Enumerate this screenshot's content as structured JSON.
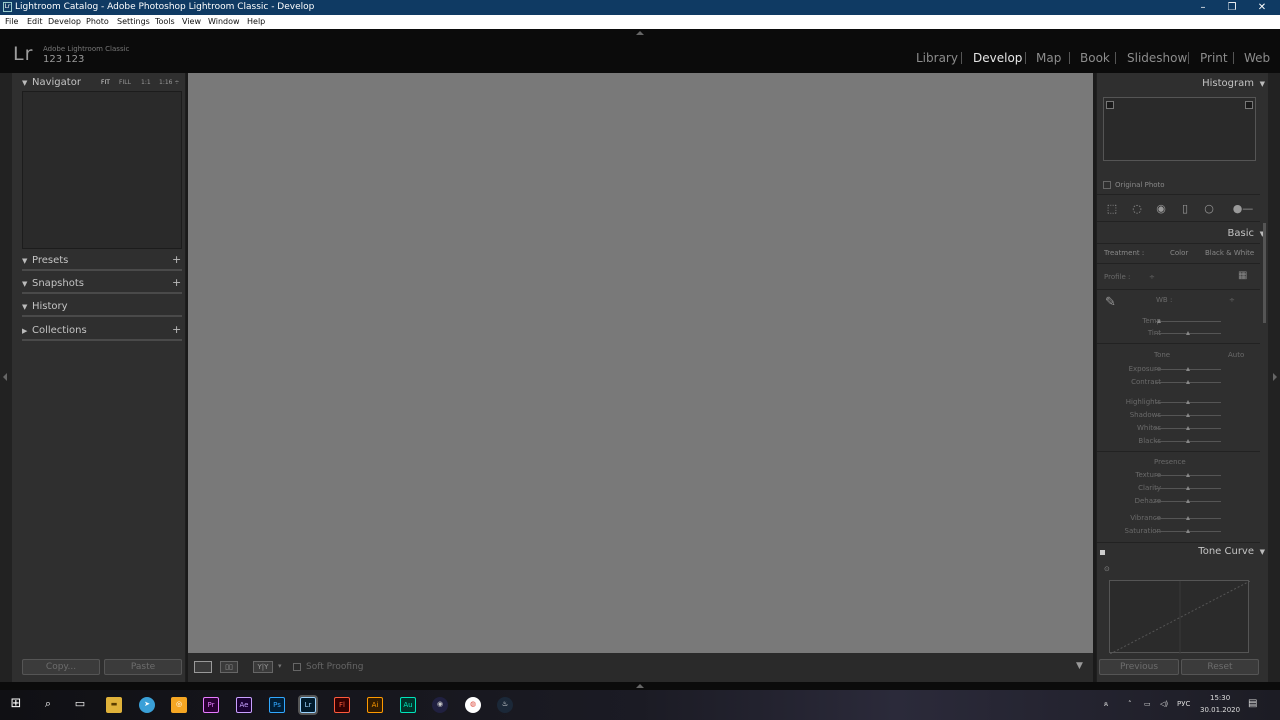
{
  "window": {
    "title": "Lightroom Catalog - Adobe Photoshop Lightroom Classic - Develop",
    "minimize": "–",
    "maximize": "❐",
    "close": "✕",
    "app_icon_text": "Lr"
  },
  "menu": [
    "File",
    "Edit",
    "Develop",
    "Photo",
    "Settings",
    "Tools",
    "View",
    "Window",
    "Help"
  ],
  "identity": {
    "logo": "Lr",
    "app_name": "Adobe Lightroom Classic",
    "plate": "123 123"
  },
  "modules": [
    "Library",
    "Develop",
    "Map",
    "Book",
    "Slideshow",
    "Print",
    "Web"
  ],
  "active_module": "Develop",
  "left_panel": {
    "navigator": {
      "title": "Navigator",
      "options": [
        "FIT",
        "FILL",
        "1:1",
        "1:16 ÷"
      ]
    },
    "presets": "Presets",
    "snapshots": "Snapshots",
    "history": "History",
    "collections": "Collections",
    "copy_button": "Copy...",
    "paste_button": "Paste",
    "add": "+"
  },
  "toolbar": {
    "soft_proofing": "Soft Proofing",
    "before_after": "Y|Y"
  },
  "right_panel": {
    "histogram": {
      "title": "Histogram",
      "original_photo": "Original Photo"
    },
    "basic": {
      "title": "Basic",
      "treatment_label": "Treatment :",
      "treatment_color": "Color",
      "treatment_bw": "Black & White",
      "profile_label": "Profile :",
      "profile_value": "÷",
      "wb_label": "WB :",
      "wb_value": "÷",
      "temp": "Temp",
      "tint": "Tint",
      "tone_label": "Tone",
      "auto": "Auto",
      "exposure": "Exposure",
      "contrast": "Contrast",
      "highlights": "Highlights",
      "shadows": "Shadows",
      "whites": "Whites",
      "blacks": "Blacks",
      "presence_label": "Presence",
      "texture": "Texture",
      "clarity": "Clarity",
      "dehaze": "Dehaze",
      "vibrance": "Vibrance",
      "saturation": "Saturation"
    },
    "tone_curve": {
      "title": "Tone Curve"
    },
    "previous_button": "Previous",
    "reset_button": "Reset"
  },
  "taskbar": {
    "apps": [
      "Pr",
      "Ae",
      "Ps",
      "Lr",
      "Fl",
      "Ai",
      "Au"
    ],
    "lang": "РУС",
    "time": "15:30",
    "date": "30.01.2020"
  }
}
